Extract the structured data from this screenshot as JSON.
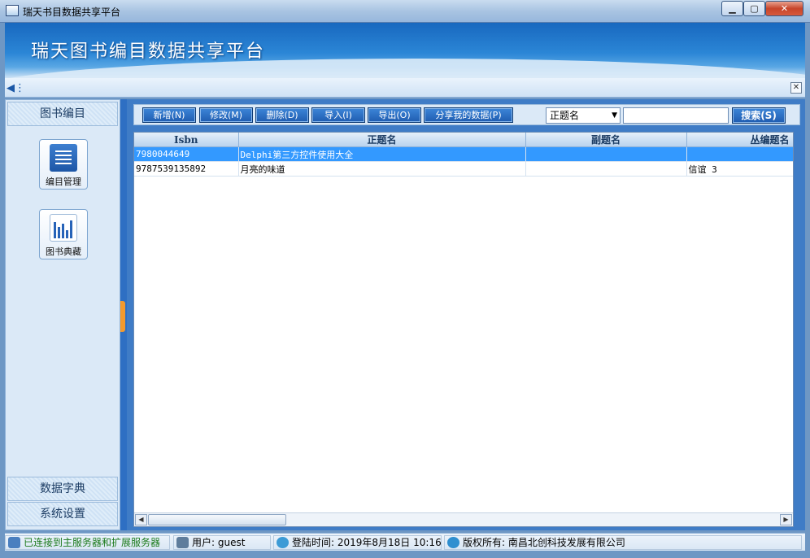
{
  "window": {
    "title": "瑞天书目数据共享平台"
  },
  "banner": {
    "title": "瑞天图书编目数据共享平台"
  },
  "sidebar": {
    "header": "图书编目",
    "items": [
      {
        "label": "编目管理",
        "icon": "catalog-list-icon"
      },
      {
        "label": "图书典藏",
        "icon": "book-collection-icon"
      }
    ],
    "bottom": [
      "数据字典",
      "系统设置"
    ]
  },
  "toolbar": {
    "buttons": [
      "新增(N)",
      "修改(M)",
      "删除(D)",
      "导入(I)",
      "导出(O)",
      "分享我的数据(P)"
    ],
    "search_field_selected": "正题名",
    "search_value": "",
    "search_button": "搜索(S)"
  },
  "grid": {
    "columns": [
      "Isbn",
      "正题名",
      "副题名",
      "丛编题名"
    ],
    "rows": [
      {
        "isbn": "7980044649",
        "title": "Delphi第三方控件使用大全",
        "subtitle": "",
        "series": "",
        "selected": true
      },
      {
        "isbn": "9787539135892",
        "title": "月亮的味道",
        "subtitle": "",
        "series": "信谊 3",
        "selected": false
      }
    ]
  },
  "status": {
    "connection": "已连接到主服务器和扩展服务器",
    "user": "用户: guest",
    "login_time": "登陆时间: 2019年8月18日 10:16",
    "copyright": "版权所有: 南昌北创科技发展有限公司"
  },
  "colors": {
    "accent": "#1f5cb0",
    "selection": "#3399ff",
    "status_ok": "#1b7a1b"
  }
}
